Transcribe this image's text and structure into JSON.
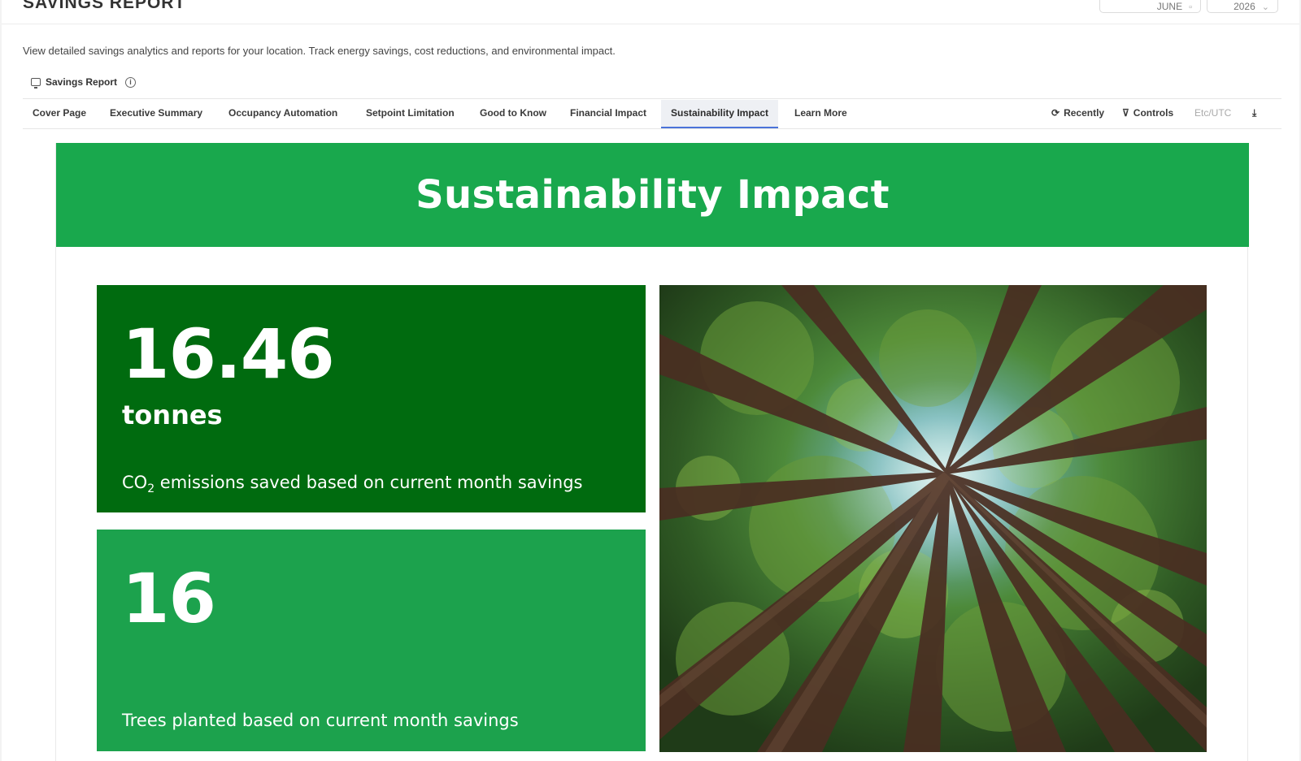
{
  "header": {
    "title": "SAVINGS REPORT",
    "month": "JUNE",
    "year": "2026",
    "description": "View detailed savings analytics and reports for your location. Track energy savings, cost reductions, and environmental impact."
  },
  "report": {
    "label": "Savings Report",
    "info_icon": "info-icon"
  },
  "tabs": [
    {
      "label": "Cover Page"
    },
    {
      "label": "Executive Summary"
    },
    {
      "label": "Occupancy Automation"
    },
    {
      "label": "Setpoint Limitation"
    },
    {
      "label": "Good to Know"
    },
    {
      "label": "Financial Impact"
    },
    {
      "label": "Sustainability Impact",
      "active": true
    },
    {
      "label": "Learn More"
    }
  ],
  "toolbar": {
    "recently": "Recently",
    "controls": "Controls",
    "timezone": "Etc/UTC",
    "download_icon": "download-icon"
  },
  "main": {
    "title": "Sustainability Impact",
    "co2": {
      "value": "16.46",
      "unit": "tonnes",
      "caption_prefix": "CO",
      "caption_sub": "2",
      "caption_suffix": " emissions saved based on current month savings"
    },
    "trees": {
      "value": "16",
      "caption": "Trees planted based on current month savings"
    }
  },
  "colors": {
    "banner": "#19a84d",
    "co2_card": "#006b0f",
    "trees_card": "#1ca24d",
    "active_tab_underline": "#4b73d9"
  }
}
